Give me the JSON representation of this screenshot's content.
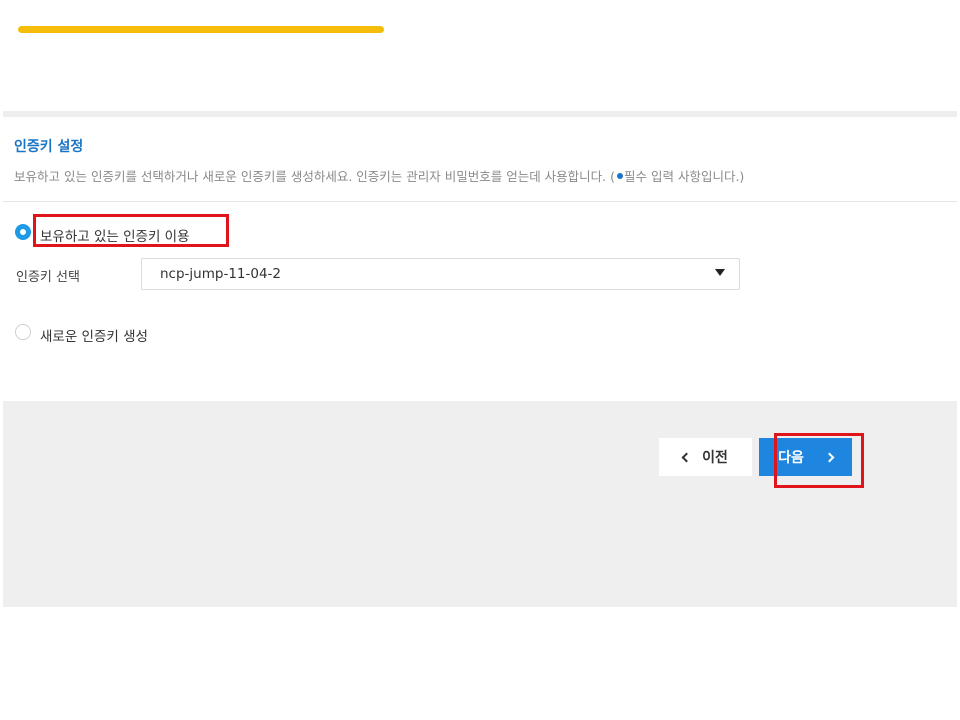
{
  "section": {
    "title": "인증키 설정",
    "description_main": "보유하고 있는 인증키를 선택하거나 새로운 인증키를 생성하세요. 인증키는 관리자 비밀번호를 얻는데 사용합니다. (",
    "description_required": "필수 입력 사항입니다.)"
  },
  "options": {
    "existing_label": "보유하고 있는 인증키 이용",
    "new_label": "새로운 인증키 생성",
    "selected": "existing"
  },
  "key_select": {
    "label": "인증키 선택",
    "value": "ncp-jump-11-04-2"
  },
  "buttons": {
    "prev_label": "이전",
    "next_label": "다음"
  },
  "colors": {
    "progress": "#f5bd0a",
    "accent": "#1c74c6",
    "primary_button": "#1f86e0",
    "highlight": "#e0141b"
  }
}
